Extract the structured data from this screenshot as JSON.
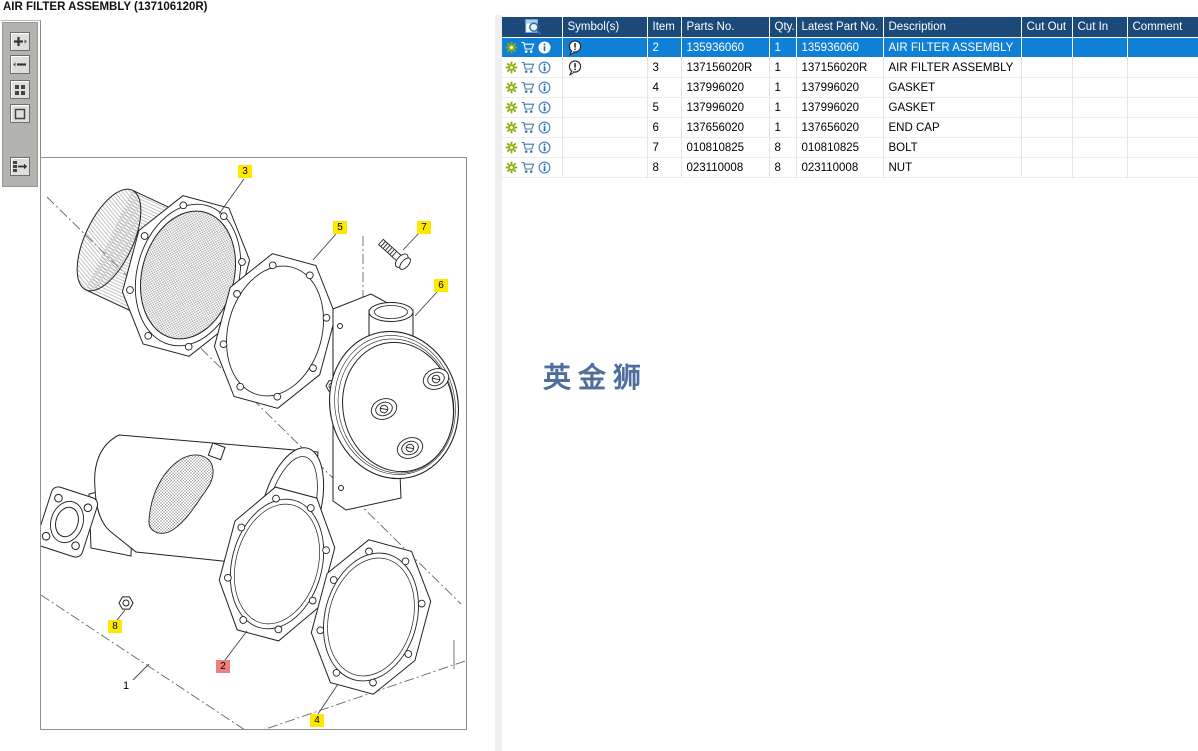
{
  "window": {
    "title": "AIR FILTER ASSEMBLY (137106120R)"
  },
  "left_toolbar": {
    "buttons": [
      {
        "name": "zoom-in"
      },
      {
        "name": "zoom-out"
      },
      {
        "name": "tile-view"
      },
      {
        "name": "fit-view"
      },
      {
        "name": "toggle-panel"
      }
    ]
  },
  "watermark": {
    "text": "英金狮",
    "color": "#4e6f9d"
  },
  "diagram": {
    "part_labels": [
      {
        "text": "3",
        "style": "yellow"
      },
      {
        "text": "5",
        "style": "yellow"
      },
      {
        "text": "7",
        "style": "yellow"
      },
      {
        "text": "6",
        "style": "yellow"
      },
      {
        "text": "8",
        "style": "yellow"
      },
      {
        "text": "2",
        "style": "red"
      },
      {
        "text": "4",
        "style": "yellow"
      },
      {
        "text": "1",
        "style": "plain"
      }
    ],
    "label_colors": {
      "yellow": "#ffe800",
      "red": "#ee8080"
    }
  },
  "table": {
    "colors": {
      "header_bg": "#1b4a7a",
      "selected_bg": "#0f80d5"
    },
    "columns": [
      {
        "label": "",
        "icon": "find-in-page-icon"
      },
      {
        "label": "Symbol(s)"
      },
      {
        "label": "Item"
      },
      {
        "label": "Parts No."
      },
      {
        "label": "Qty."
      },
      {
        "label": "Latest Part No."
      },
      {
        "label": "Description"
      },
      {
        "label": "Cut Out"
      },
      {
        "label": "Cut In"
      },
      {
        "label": "Comment"
      }
    ],
    "row_action_icons": [
      "gear-icon",
      "cart-icon",
      "info-icon"
    ],
    "rows": [
      {
        "symbol": "balloon-icon",
        "item": "2",
        "parts_no": "135936060",
        "qty": "1",
        "latest_part_no": "135936060",
        "description": "AIR FILTER ASSEMBLY",
        "cut_out": "",
        "cut_in": "",
        "comment": "",
        "selected": true
      },
      {
        "symbol": "balloon-icon",
        "item": "3",
        "parts_no": "137156020R",
        "qty": "1",
        "latest_part_no": "137156020R",
        "description": "AIR FILTER ASSEMBLY",
        "cut_out": "",
        "cut_in": "",
        "comment": "",
        "selected": false
      },
      {
        "symbol": "",
        "item": "4",
        "parts_no": "137996020",
        "qty": "1",
        "latest_part_no": "137996020",
        "description": "GASKET",
        "cut_out": "",
        "cut_in": "",
        "comment": "",
        "selected": false
      },
      {
        "symbol": "",
        "item": "5",
        "parts_no": "137996020",
        "qty": "1",
        "latest_part_no": "137996020",
        "description": "GASKET",
        "cut_out": "",
        "cut_in": "",
        "comment": "",
        "selected": false
      },
      {
        "symbol": "",
        "item": "6",
        "parts_no": "137656020",
        "qty": "1",
        "latest_part_no": "137656020",
        "description": "END CAP",
        "cut_out": "",
        "cut_in": "",
        "comment": "",
        "selected": false
      },
      {
        "symbol": "",
        "item": "7",
        "parts_no": "010810825",
        "qty": "8",
        "latest_part_no": "010810825",
        "description": "BOLT",
        "cut_out": "",
        "cut_in": "",
        "comment": "",
        "selected": false
      },
      {
        "symbol": "",
        "item": "8",
        "parts_no": "023110008",
        "qty": "8",
        "latest_part_no": "023110008",
        "description": "NUT",
        "cut_out": "",
        "cut_in": "",
        "comment": "",
        "selected": false
      }
    ]
  }
}
